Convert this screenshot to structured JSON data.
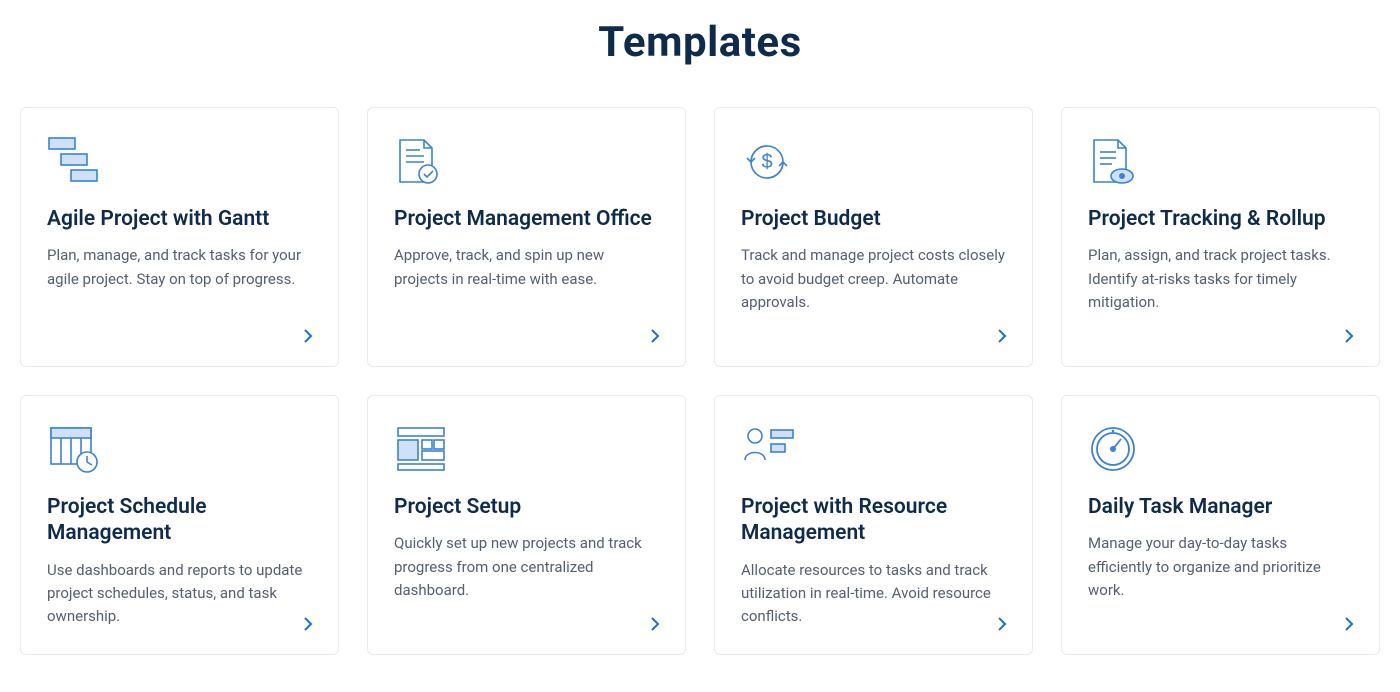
{
  "title": "Templates",
  "templates": [
    {
      "icon": "gantt-icon",
      "title": "Agile Project with Gantt",
      "desc": "Plan, manage, and track tasks for your agile project. Stay on top of progress."
    },
    {
      "icon": "document-check-icon",
      "title": "Project Management Office",
      "desc": "Approve, track, and spin up new projects in real-time with ease."
    },
    {
      "icon": "budget-icon",
      "title": "Project Budget",
      "desc": "Track and manage project costs closely to avoid budget creep. Automate approvals."
    },
    {
      "icon": "document-eye-icon",
      "title": "Project Tracking & Rollup",
      "desc": "Plan, assign, and track project tasks. Identify at-risks tasks for timely mitigation."
    },
    {
      "icon": "schedule-icon",
      "title": "Project Schedule Management",
      "desc": "Use dashboards and reports to update project schedules, status, and task ownership."
    },
    {
      "icon": "setup-icon",
      "title": "Project Setup",
      "desc": "Quickly set up new projects and track progress from one centralized dashboard."
    },
    {
      "icon": "resource-icon",
      "title": "Project with Resource Management",
      "desc": "Allocate resources to tasks and track utilization in real-time. Avoid resource conflicts."
    },
    {
      "icon": "gauge-icon",
      "title": "Daily Task Manager",
      "desc": "Manage your day-to-day tasks efficiently to organize and prioritize work."
    }
  ]
}
